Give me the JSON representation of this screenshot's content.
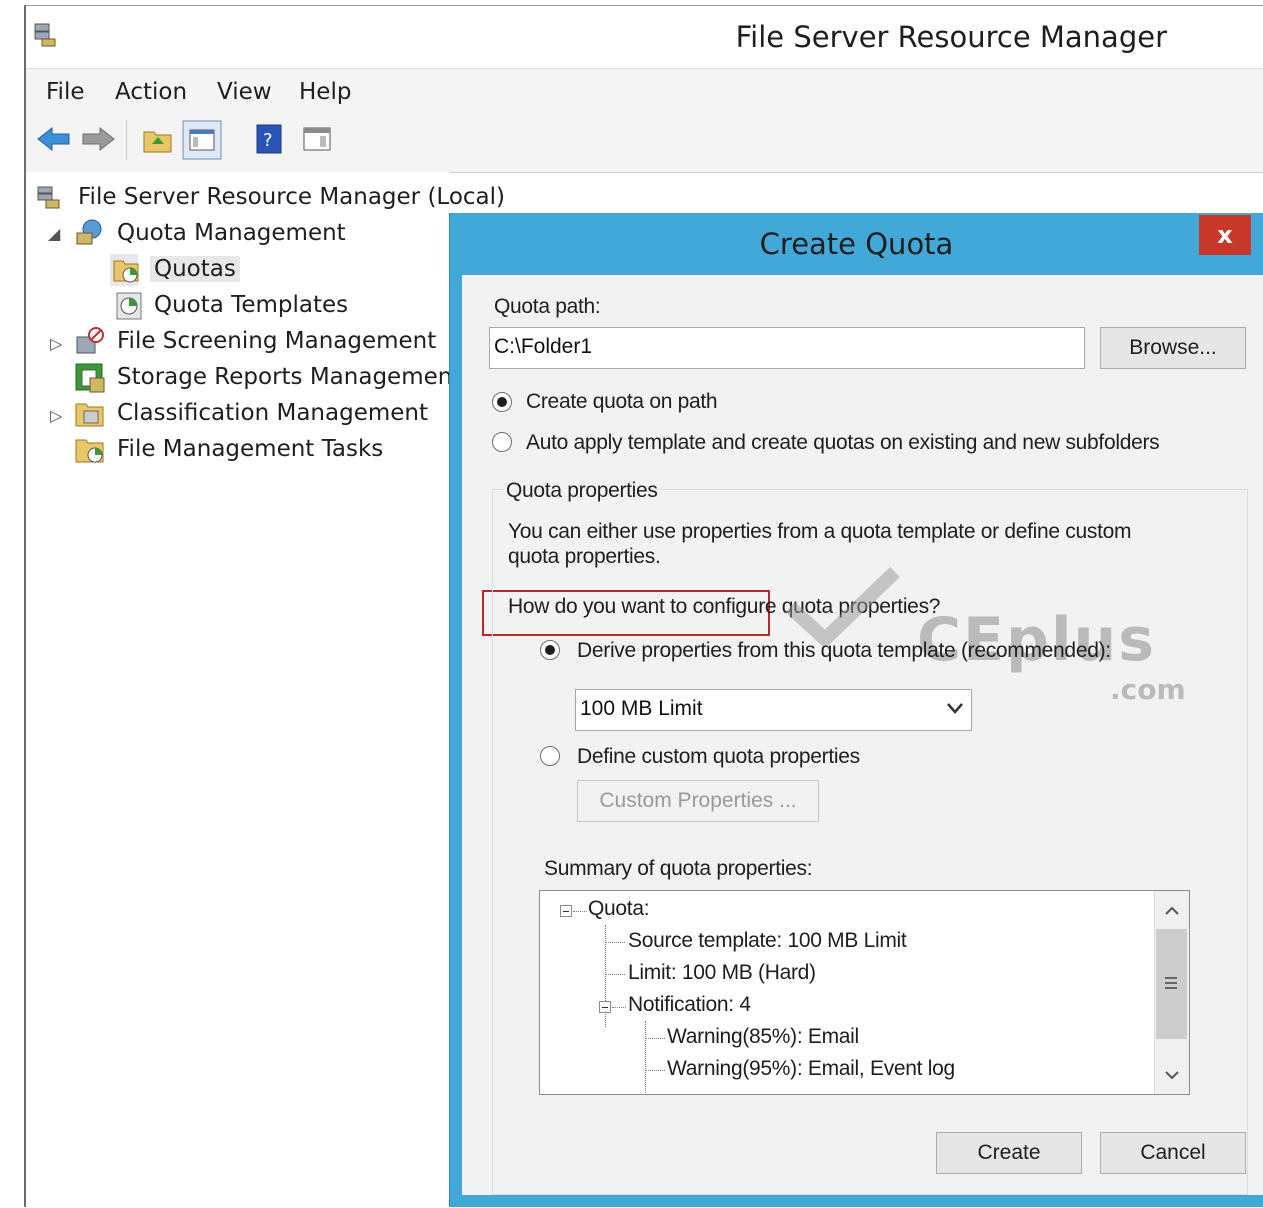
{
  "window": {
    "title": "File Server Resource Manager"
  },
  "menu": [
    "File",
    "Action",
    "View",
    "Help"
  ],
  "toolbar": {
    "icons": [
      "back-icon",
      "forward-icon",
      "up-folder-icon",
      "show-hide-console-tree-icon",
      "help-icon",
      "show-hide-action-pane-icon"
    ]
  },
  "tree": {
    "root": "File Server Resource Manager (Local)",
    "quota_management": "Quota Management",
    "quotas": "Quotas",
    "quota_templates": "Quota Templates",
    "file_screening": "File Screening Management",
    "storage_reports": "Storage Reports Management",
    "classification": "Classification Management",
    "file_management_tasks": "File Management Tasks"
  },
  "dialog": {
    "title": "Create Quota",
    "close": "x",
    "quota_path_label": "Quota path:",
    "quota_path_value": "C:\\Folder1",
    "browse": "Browse...",
    "radio_create": "Create quota on path",
    "radio_auto": "Auto apply template and create quotas on existing and new subfolders",
    "group_label": "Quota properties",
    "desc_line1": "You can either use properties from a quota template or define custom",
    "desc_line2": "quota properties.",
    "how_label": "How do you want to configure quota properties?",
    "radio_derive": "Derive properties from this quota template (recommended):",
    "template_selected": "100 MB Limit",
    "radio_custom": "Define custom quota properties",
    "custom_button": "Custom Properties ...",
    "summary_label": "Summary of quota properties:",
    "summary": {
      "quota": "Quota:",
      "source": "Source template: 100 MB Limit",
      "limit": "Limit: 100 MB (Hard)",
      "notification": "Notification: 4",
      "warn85": "Warning(85%): Email",
      "warn95": "Warning(95%): Email, Event log"
    },
    "create": "Create",
    "cancel": "Cancel"
  },
  "watermark": {
    "main": "CEplus",
    "sub": ".com"
  }
}
